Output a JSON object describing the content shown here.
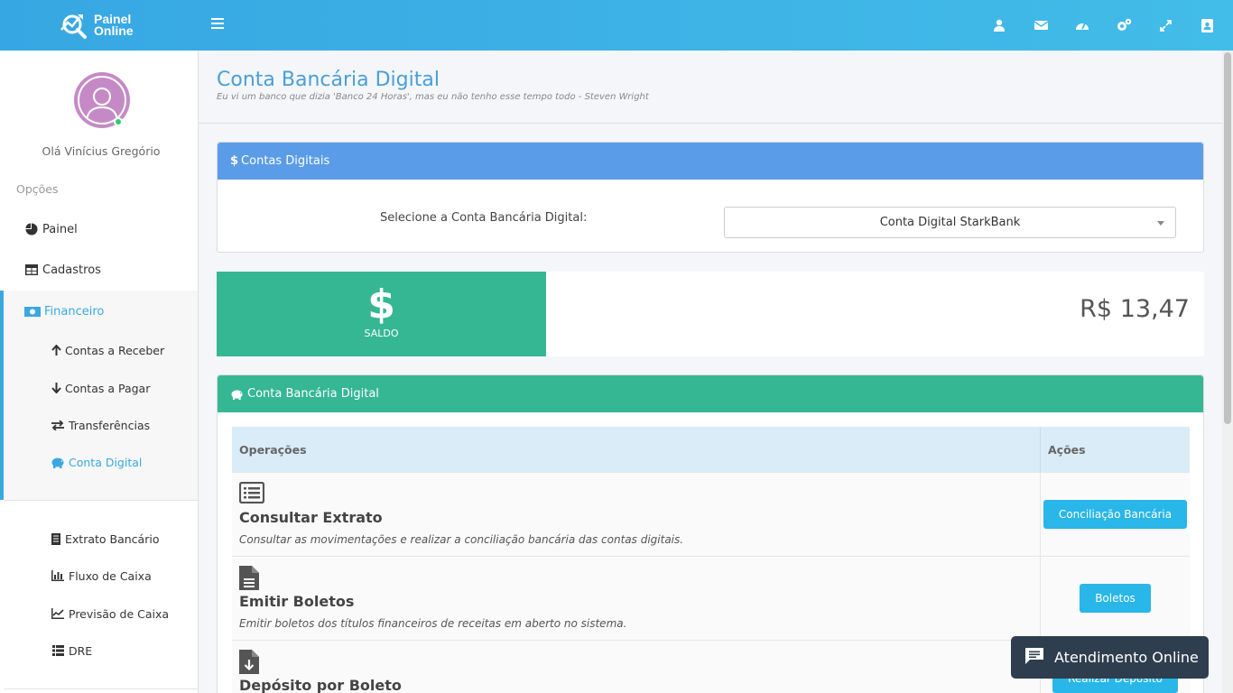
{
  "app": {
    "logo_line1": "Painel",
    "logo_line2": "Online"
  },
  "topbar": {
    "icons": [
      "user-icon",
      "mail-icon",
      "dashboard-icon",
      "settings-icon",
      "fullscreen-icon",
      "contacts-icon"
    ]
  },
  "sidebar": {
    "greeting": "Olá Vinícius Gregório",
    "section_label": "Opções",
    "items": [
      {
        "label": "Painel",
        "icon": "pie-chart-icon"
      },
      {
        "label": "Cadastros",
        "icon": "table-icon"
      },
      {
        "label": "Financeiro",
        "icon": "money-icon"
      }
    ],
    "financeiro_sub": [
      {
        "label": "Contas a Receber",
        "icon": "arrow-up-icon"
      },
      {
        "label": "Contas a Pagar",
        "icon": "arrow-down-icon"
      },
      {
        "label": "Transferências",
        "icon": "exchange-icon"
      },
      {
        "label": "Conta Digital",
        "icon": "piggy-bank-icon"
      }
    ],
    "reports": [
      {
        "label": "Extrato Bancário",
        "icon": "receipt-icon"
      },
      {
        "label": "Fluxo de Caixa",
        "icon": "bar-chart-icon"
      },
      {
        "label": "Previsão de Caixa",
        "icon": "line-chart-icon"
      },
      {
        "label": "DRE",
        "icon": "list-icon"
      }
    ]
  },
  "page": {
    "title": "Conta Bancária Digital",
    "quote": "Eu vi um banco que dizia 'Banco 24 Horas', mas eu não tenho esse tempo todo - Steven Wright"
  },
  "contas_card": {
    "header": "Contas Digitais",
    "select_label": "Selecione a Conta Bancária Digital:",
    "select_value": "Conta Digital StarkBank"
  },
  "saldo": {
    "symbol": "$",
    "label": "SALDO",
    "value": "R$ 13,47"
  },
  "ops_card": {
    "header": "Conta Bancária Digital",
    "col_operacoes": "Operações",
    "col_acoes": "Ações",
    "rows": [
      {
        "title": "Consultar Extrato",
        "desc": "Consultar as movimentações e realizar a conciliação bancária das contas digitais.",
        "action": "Conciliação Bancária",
        "icon": "list-alt-icon"
      },
      {
        "title": "Emitir Boletos",
        "desc": "Emitir boletos dos títulos financeiros de receitas em aberto no sistema.",
        "action": "Boletos",
        "icon": "document-icon"
      },
      {
        "title": "Depósito por Boleto",
        "desc": "",
        "action": "Realizar Depósito",
        "icon": "download-file-icon"
      }
    ]
  },
  "chat": {
    "label": "Atendimento Online"
  },
  "colors": {
    "topbar": "#3fb4e6",
    "primary_blue": "#5b9ce8",
    "green": "#36b794",
    "button": "#29b6e8",
    "chat_bg": "#2f3e4f"
  }
}
